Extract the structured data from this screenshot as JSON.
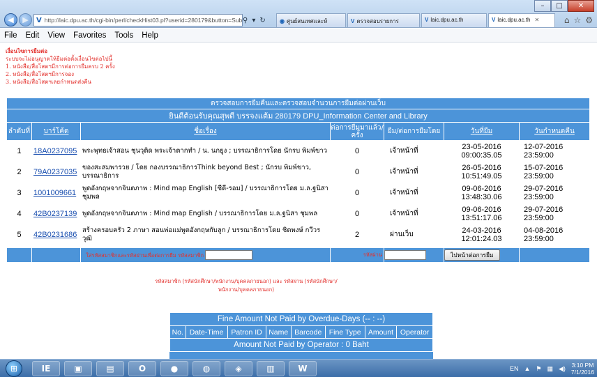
{
  "browser": {
    "url": "http://laic.dpu.ac.th/cgi-bin/perl/checkHist03.pl?userid=280179&button=Sub",
    "tabs": [
      {
        "label": "ศูนย์สนเทศและห้"
      },
      {
        "label": "ตรวจสอบรายการ"
      },
      {
        "label": "laic.dpu.ac.th"
      },
      {
        "label": "laic.dpu.ac.th"
      }
    ],
    "window": {
      "minimize": "–",
      "maximize": "□",
      "close": "✕"
    }
  },
  "menu": [
    "File",
    "Edit",
    "View",
    "Favorites",
    "Tools",
    "Help"
  ],
  "notes": {
    "title": "เงื่อนไขการยืมต่อ",
    "intro": "ระบบจะไม่อนุญาตให้ยืมต่อตั้งเงื่อนไขต่อไปนี้",
    "items": [
      "1. หนังสือ/สื่อโสตฯมีการต่อการยืมครบ 2 ครั้ง",
      "2. หนังสือ/สื่อโสตฯมีการจอง",
      "3. หนังสือ/สื่อโสตฯเลยกำหนดส่งคืน"
    ]
  },
  "table": {
    "title": "ตรวจสอบการยืมคืนและตรวจสอบจำนวนการยืมต่อผ่านเว็บ",
    "welcome": "ยินดีต้อนรับคุณสุพดี บรรจงแต้ม 280179 DPU_Information Center and Library",
    "headers": {
      "no": "ลำดับที่",
      "barcode": "บาร์โค้ด",
      "title": "ชื่อเรื่อง",
      "renew_count": "ต่อการยืมมาแล้ว/ครั้ง",
      "renewed_by": "ยืม/ต่อการยืมโดย",
      "borrow_date": "วันที่ยืม",
      "due_date": "วันกำหนดคืน"
    },
    "rows": [
      {
        "no": "1",
        "barcode": "18A0237095",
        "title": "พระพุทธเจ้าสอน ชุนวุติด พระเจ้าตากทำ / น. นกยูง ; บรรณาธิการโดย นักรบ พิมพ์ขาว",
        "renew_count": "0",
        "renewed_by": "เจ้าหน้าที่",
        "borrow_date": "23-05-2016",
        "borrow_time": "09:00:35.05",
        "due_date": "12-07-2016",
        "due_time": "23:59:00"
      },
      {
        "no": "2",
        "barcode": "79A0237035",
        "title": "ของสะสมพารวย / โดย กองบรรณาธิการThink beyond Best ; นักรบ พิมพ์ขาว, บรรณาธิการ",
        "renew_count": "0",
        "renewed_by": "เจ้าหน้าที่",
        "borrow_date": "26-05-2016",
        "borrow_time": "10:51:49.05",
        "due_date": "15-07-2016",
        "due_time": "23:59:00"
      },
      {
        "no": "3",
        "barcode": "1001009661",
        "title": "พูดอังกฤษจากจินตภาพ : Mind map English [ซีดี-รอม] / บรรณาธิการโดย ม.ล.ฐนิสา ชุมพล",
        "renew_count": "0",
        "renewed_by": "เจ้าหน้าที่",
        "borrow_date": "09-06-2016",
        "borrow_time": "13:48:30.06",
        "due_date": "29-07-2016",
        "due_time": "23:59:00"
      },
      {
        "no": "4",
        "barcode": "42B0237139",
        "title": "พูดอังกฤษจากจินตภาพ : Mind map English / บรรณาธิการโดย ม.ล.ฐนิสา ชุมพล",
        "renew_count": "0",
        "renewed_by": "เจ้าหน้าที่",
        "borrow_date": "09-06-2016",
        "borrow_time": "13:51:17.06",
        "due_date": "29-07-2016",
        "due_time": "23:59:00"
      },
      {
        "no": "5",
        "barcode": "42B0231686",
        "title": "สร้างครอบครัว 2 ภาษา สอนพ่อแม่พูดอังกฤษกับลูก / บรรณาธิการโดย ชิดพงษ์ กวีวรวุฒิ",
        "renew_count": "2",
        "renewed_by": "ผ่านเว็บ",
        "borrow_date": "24-03-2016",
        "borrow_time": "12:01:24.03",
        "due_date": "04-08-2016",
        "due_time": "23:59:00"
      }
    ]
  },
  "form": {
    "member_label": "ใส่รหัสสมาชิกและรหัสผ่านเพื่อต่อการยืม  รหัสสมาชิก",
    "password_label": "รหัสผ่าน",
    "member_value": "",
    "password_value": "",
    "submit_label": "ไปหน้าต่อการยืม",
    "hint": "รหัสสมาชิก (รหัสนักศึกษา/พนักงาน/บุคคลภายนอก) และ รหัสผ่าน (รหัสนักศึกษา/พนักงาน/บุคคลภายนอก)"
  },
  "fine": {
    "title": "Fine Amount Not Paid by Overdue-Days (-- : --)",
    "columns": [
      "No.",
      "Date-Time",
      "Patron ID",
      "Name",
      "Barcode",
      "Fine Type",
      "Amount",
      "Operator"
    ],
    "operator_title": "Amount Not Paid by Operator : 0 Baht"
  },
  "taskbar": {
    "apps": [
      "IE",
      "O",
      "W"
    ],
    "lang": "EN",
    "time": "3:10 PM",
    "date": "7/1/2016"
  }
}
